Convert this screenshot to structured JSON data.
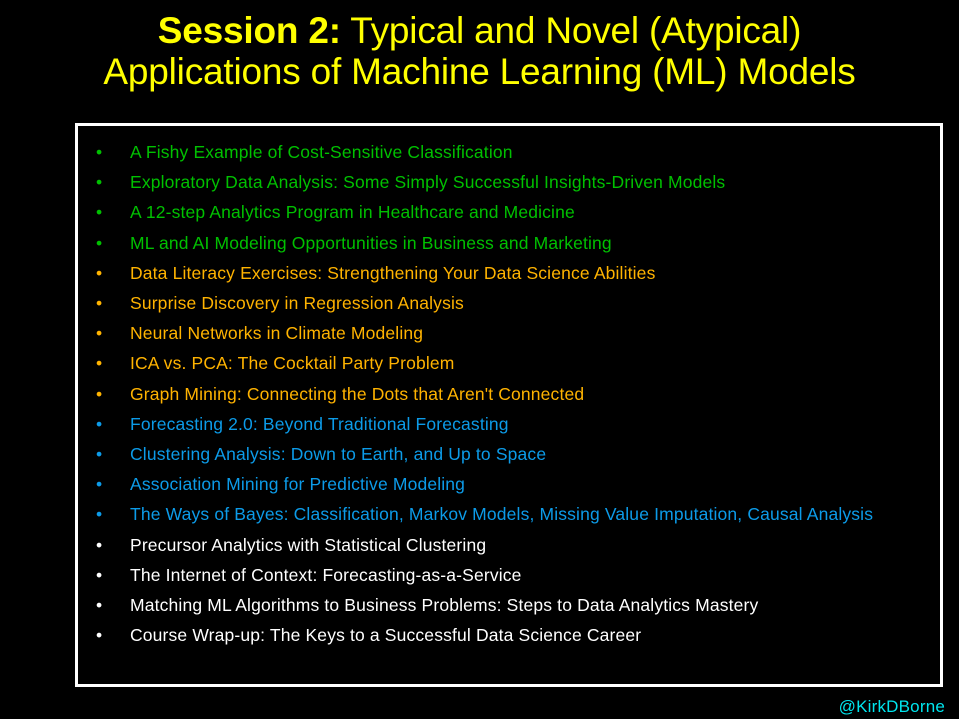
{
  "slide": {
    "background_color": "#000000",
    "frame_border_color": "#FFFFFF"
  },
  "title": {
    "line1_strong": "Session 2:",
    "line1_rest": "  Typical and Novel (Atypical)",
    "line2": "Applications of Machine Learning (ML) Models",
    "color": "#FFFF00"
  },
  "colors": {
    "green": "#00C000",
    "orange": "#FFB300",
    "blue": "#0C9BE8",
    "white": "#FFFFFF",
    "cyan": "#00E5EE",
    "yellow": "#FFFF00"
  },
  "list": {
    "bullet_glyph": "•",
    "items": [
      {
        "text": "A Fishy Example of Cost-Sensitive  Classification",
        "color": "#00C000"
      },
      {
        "text": "Exploratory  Data Analysis:  Some  Simply  Successful  Insights-Driven  Models",
        "color": "#00C000"
      },
      {
        "text": "A 12-step Analytics  Program in Healthcare  and  Medicine",
        "color": "#00C000"
      },
      {
        "text": "ML and AI Modeling  Opportunities  in Business  and  Marketing",
        "color": "#00C000"
      },
      {
        "text": "Data Literacy  Exercises: Strengthening  Your Data Science  Abilities",
        "color": "#FFB300"
      },
      {
        "text": "Surprise  Discovery  in Regression  Analysis",
        "color": "#FFB300"
      },
      {
        "text": "Neural Networks in Climate  Modeling",
        "color": "#FFB300"
      },
      {
        "text": "ICA vs.  PCA: The Cocktail  Party Problem",
        "color": "#FFB300"
      },
      {
        "text": "Graph Mining:  Connecting  the Dots that Aren't Connected",
        "color": "#FFB300"
      },
      {
        "text": "Forecasting  2.0: Beyond  Traditional  Forecasting",
        "color": "#0C9BE8"
      },
      {
        "text": "Clustering  Analysis:  Down to Earth, and Up to Space",
        "color": "#0C9BE8"
      },
      {
        "text": "Association  Mining  for Predictive  Modeling",
        "color": "#0C9BE8"
      },
      {
        "text": "The Ways of Bayes:  Classification,  Markov Models,  Missing  Value  Imputation,  Causal  Analysis",
        "color": "#0C9BE8"
      },
      {
        "text": "Precursor Analytics  with Statistical  Clustering",
        "color": "#FFFFFF"
      },
      {
        "text": "The Internet of Context: Forecasting-as-a-Service",
        "color": "#FFFFFF"
      },
      {
        "text": "Matching  ML Algorithms  to Business  Problems:  Steps  to Data Analytics  Mastery",
        "color": "#FFFFFF"
      },
      {
        "text": "Course Wrap-up: The Keys to a Successful  Data Science  Career",
        "color": "#FFFFFF"
      }
    ]
  },
  "signature": {
    "handle": "@KirkDBorne",
    "color": "#00E5EE"
  }
}
